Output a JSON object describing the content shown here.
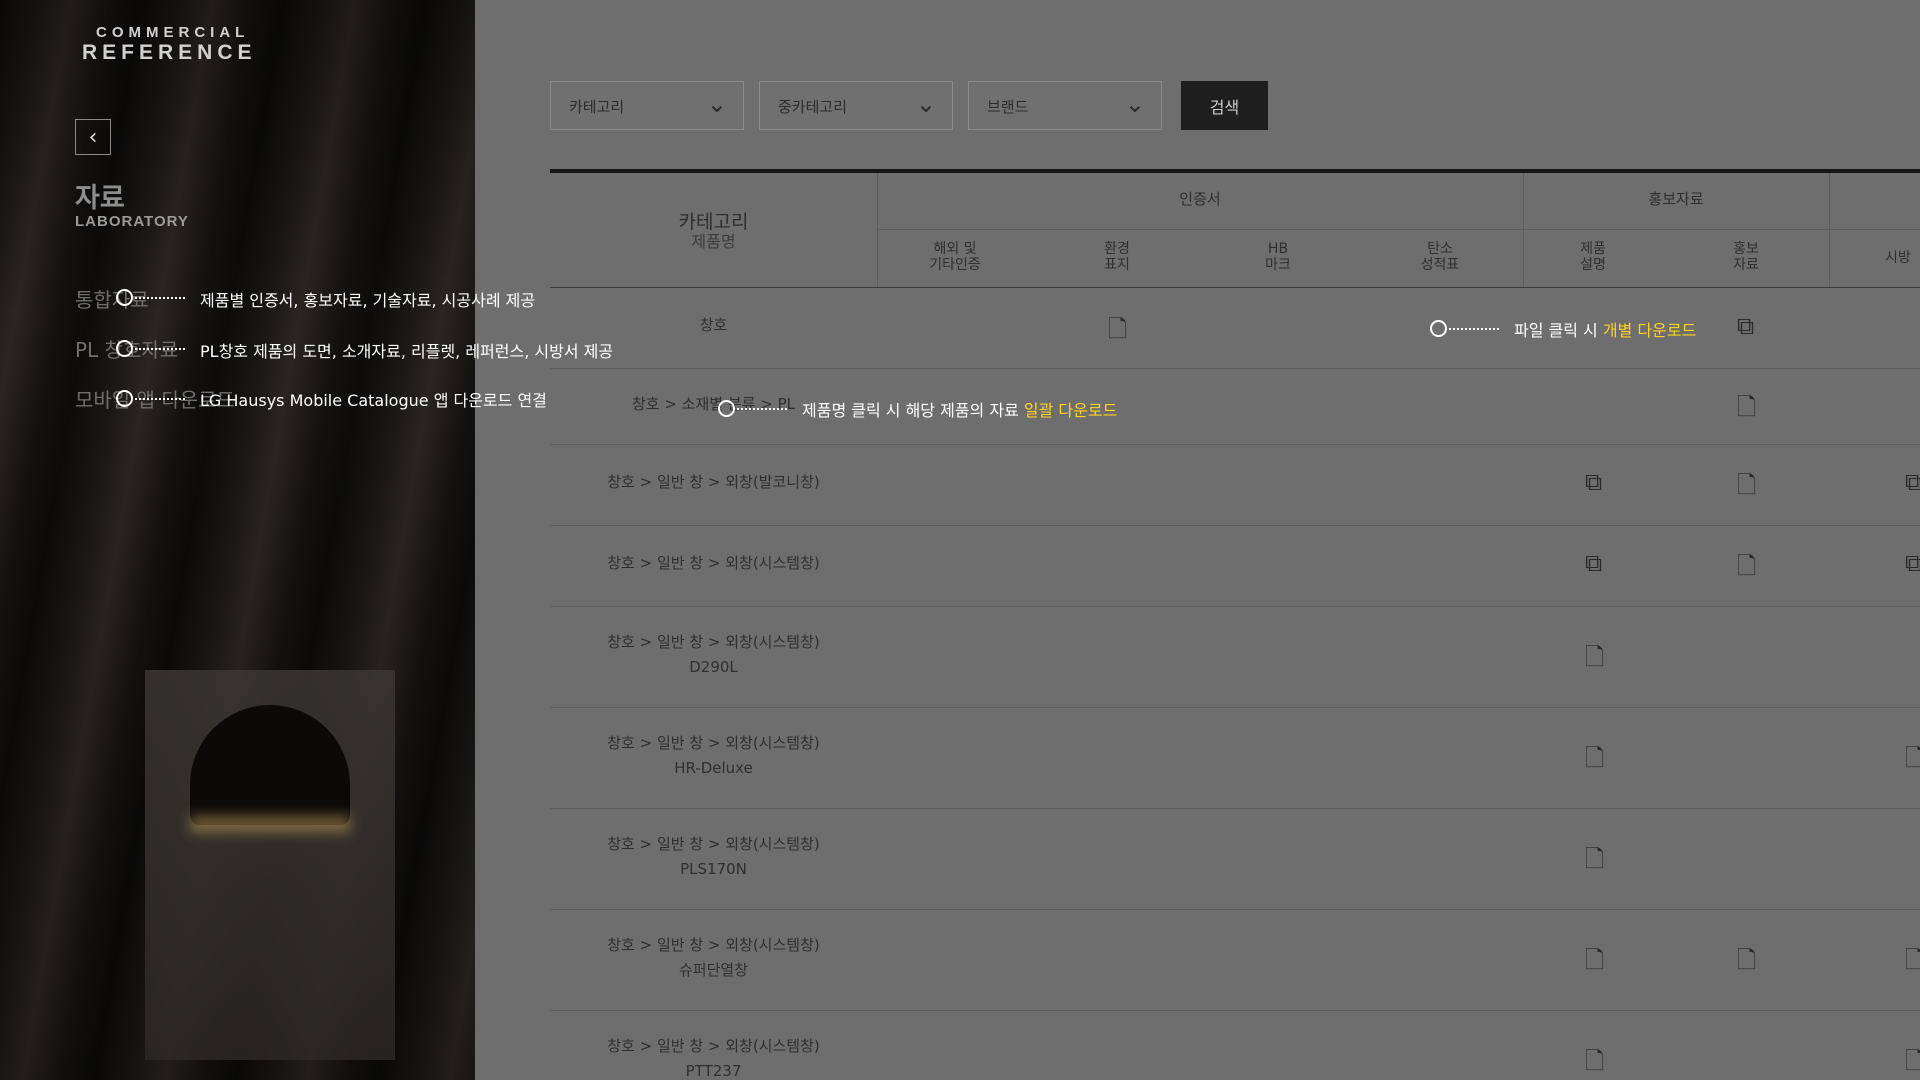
{
  "logo": {
    "line1": "COMMERCIAL",
    "line2": "REFERENCE"
  },
  "nav": {
    "back_icon": "chevron-left-icon",
    "back_glyph": "‹"
  },
  "page": {
    "title": "자료",
    "subtitle": "LABORATORY"
  },
  "menu": [
    "통합자료",
    "PL 창호자료",
    "모바일 앱 다운로드"
  ],
  "filters": [
    {
      "label": "카테고리",
      "icon": "chevron-down-icon"
    },
    {
      "label": "중카테고리",
      "icon": "chevron-down-icon"
    },
    {
      "label": "브랜드",
      "icon": "chevron-down-icon"
    }
  ],
  "search": {
    "label": "검색"
  },
  "table": {
    "group_headers": [
      "인증서",
      "홍보자료"
    ],
    "col_main": [
      "카테고리",
      "제품명"
    ],
    "columns": [
      "해외 및\n기타인증",
      "환경\n표지",
      "HB\n마크",
      "탄소\n성적표",
      "제품\n설명",
      "홍보\n자료",
      "시방"
    ],
    "rows": [
      {
        "category": "창호",
        "product": ""
      },
      {
        "category": "창호 > 소재별 분류 > PL",
        "product": ""
      },
      {
        "category": "창호 > 일반 창 > 외창(발코니창)",
        "product": ""
      },
      {
        "category": "창호 > 일반 창 > 외창(시스템창)",
        "product": ""
      },
      {
        "category": "창호 > 일반 창 > 외창(시스템창)",
        "product": "D290L"
      },
      {
        "category": "창호 > 일반 창 > 외창(시스템창)",
        "product": "HR-Deluxe"
      },
      {
        "category": "창호 > 일반 창 > 외창(시스템창)",
        "product": "PLS170N"
      },
      {
        "category": "창호 > 일반 창 > 외창(시스템창)",
        "product": "슈퍼단열창"
      },
      {
        "category": "창호 > 일반 창 > 외창(시스템창)",
        "product": "PTT237"
      }
    ],
    "file_icon": "file-icon",
    "multi_file_icon": "multi-file-icon"
  },
  "annotations": {
    "a1": "제품별 인증서, 홍보자료, 기술자료, 시공사례 제공",
    "a2": "PL창호 제품의 도면, 소개자료, 리플렛, 레퍼런스, 시방서 제공",
    "a3": "LG Hausys Mobile Catalogue 앱 다운로드 연결",
    "a4_pre": "제품명 클릭 시 해당 제품의 자료 ",
    "a4_hl": "일괄 다운로드",
    "a5_pre": "파일 클릭 시 ",
    "a5_hl": "개별 다운로드"
  },
  "colors": {
    "highlight": "#ffd322",
    "dim_overlay": "#6e6e6e",
    "annotation": "#ffffff"
  }
}
